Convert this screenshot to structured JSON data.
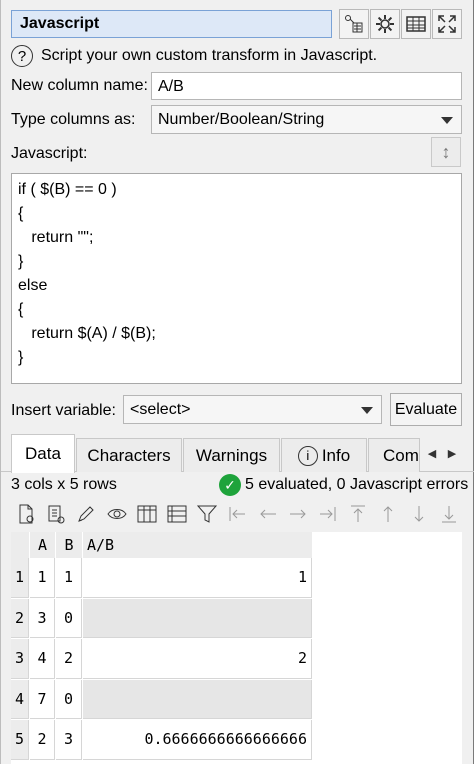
{
  "panel": {
    "title": "Javascript",
    "help_text": "Script your own custom transform in Javascript.",
    "help_icon_label": "?"
  },
  "toolbar_icons": [
    "formula-icon",
    "gear-icon",
    "table-icon",
    "expand-icon"
  ],
  "form": {
    "new_column_label": "New column name:",
    "new_column_value": "A/B",
    "type_columns_label": "Type columns as:",
    "type_columns_value": "Number/Boolean/String",
    "javascript_label": "Javascript:",
    "code": "if ( $(B) == 0 )\n{\n   return \"\";\n}\nelse\n{\n   return $(A) / $(B);\n}",
    "insert_variable_label": "Insert variable:",
    "insert_variable_value": "<select>",
    "evaluate_button": "Evaluate"
  },
  "tabs": [
    {
      "label": "Data",
      "active": true
    },
    {
      "label": "Characters"
    },
    {
      "label": "Warnings"
    },
    {
      "label": "Info",
      "icon": "info-icon"
    },
    {
      "label": "Comm"
    }
  ],
  "tab_scroll": {
    "left": "◀",
    "right": "▶"
  },
  "status": {
    "shape": "3 cols x 5 rows",
    "summary": "5 evaluated, 0 Javascript errors",
    "ok_color": "#1ea33b"
  },
  "grid_toolbar_icons": [
    "new-doc-icon",
    "paste-icon",
    "pencil-icon",
    "eye-icon",
    "columns-icon",
    "rows-icon",
    "filter-icon",
    "first-col-icon",
    "prev-col-icon",
    "next-col-icon",
    "last-col-icon",
    "top-row-icon",
    "up-row-icon",
    "down-row-icon",
    "bottom-row-icon"
  ],
  "grid": {
    "columns": [
      "A",
      "B",
      "A/B"
    ],
    "rows": [
      {
        "n": "1",
        "A": "1",
        "B": "1",
        "AB": "1"
      },
      {
        "n": "2",
        "A": "3",
        "B": "0",
        "AB": ""
      },
      {
        "n": "3",
        "A": "4",
        "B": "2",
        "AB": "2"
      },
      {
        "n": "4",
        "A": "7",
        "B": "0",
        "AB": ""
      },
      {
        "n": "5",
        "A": "2",
        "B": "3",
        "AB": "0.6666666666666666"
      }
    ],
    "empty_row_color": "#e6e6e6"
  }
}
